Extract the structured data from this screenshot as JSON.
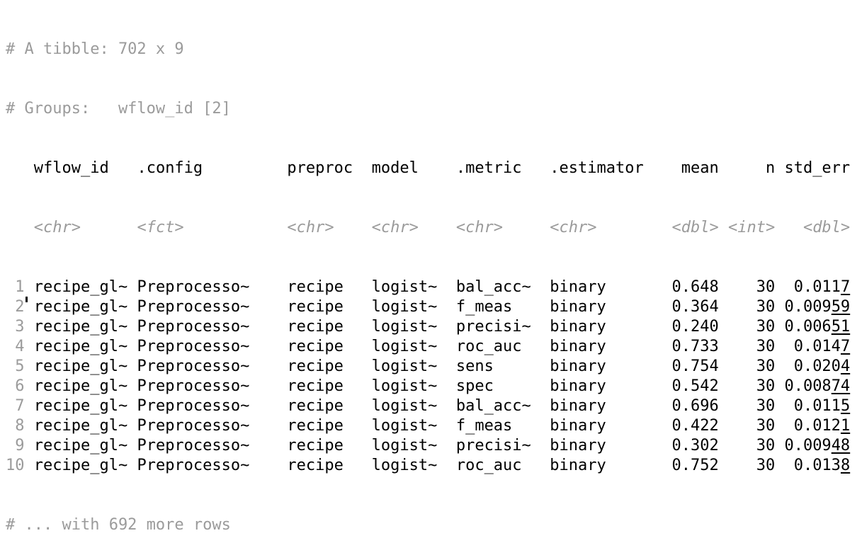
{
  "header": {
    "tibble_line": "# A tibble: 702 x 9",
    "groups_line": "# Groups:   wflow_id [2]"
  },
  "columns": [
    {
      "name": "wflow_id",
      "type": "<chr>",
      "width": 10,
      "align": "left"
    },
    {
      "name": ".config",
      "type": "<fct>",
      "width": 15,
      "align": "left"
    },
    {
      "name": "preproc",
      "type": "<chr>",
      "width": 8,
      "align": "left"
    },
    {
      "name": "model",
      "type": "<chr>",
      "width": 8,
      "align": "left"
    },
    {
      "name": ".metric",
      "type": "<chr>",
      "width": 9,
      "align": "left"
    },
    {
      "name": ".estimator",
      "type": "<chr>",
      "width": 10,
      "align": "left"
    },
    {
      "name": "mean",
      "type": "<dbl>",
      "width": 7,
      "align": "right"
    },
    {
      "name": "n",
      "type": "<int>",
      "width": 5,
      "align": "right"
    },
    {
      "name": "std_err",
      "type": "<dbl>",
      "width": 7,
      "align": "right"
    }
  ],
  "rows": [
    {
      "num": "1",
      "cells": [
        "recipe_gl~",
        "Preprocesso~",
        "recipe",
        "logist~",
        "bal_acc~",
        "binary",
        "0.648",
        "30"
      ],
      "se_main": "0.011",
      "se_ul": "7"
    },
    {
      "num": "2",
      "cells": [
        "recipe_gl~",
        "Preprocesso~",
        "recipe",
        "logist~",
        "f_meas",
        "binary",
        "0.364",
        "30"
      ],
      "se_main": "0.009",
      "se_ul": "59"
    },
    {
      "num": "3",
      "cells": [
        "recipe_gl~",
        "Preprocesso~",
        "recipe",
        "logist~",
        "precisi~",
        "binary",
        "0.240",
        "30"
      ],
      "se_main": "0.006",
      "se_ul": "51"
    },
    {
      "num": "4",
      "cells": [
        "recipe_gl~",
        "Preprocesso~",
        "recipe",
        "logist~",
        "roc_auc",
        "binary",
        "0.733",
        "30"
      ],
      "se_main": "0.014",
      "se_ul": "7"
    },
    {
      "num": "5",
      "cells": [
        "recipe_gl~",
        "Preprocesso~",
        "recipe",
        "logist~",
        "sens",
        "binary",
        "0.754",
        "30"
      ],
      "se_main": "0.020",
      "se_ul": "4"
    },
    {
      "num": "6",
      "cells": [
        "recipe_gl~",
        "Preprocesso~",
        "recipe",
        "logist~",
        "spec",
        "binary",
        "0.542",
        "30"
      ],
      "se_main": "0.008",
      "se_ul": "74"
    },
    {
      "num": "7",
      "cells": [
        "recipe_gl~",
        "Preprocesso~",
        "recipe",
        "logist~",
        "bal_acc~",
        "binary",
        "0.696",
        "30"
      ],
      "se_main": "0.011",
      "se_ul": "5"
    },
    {
      "num": "8",
      "cells": [
        "recipe_gl~",
        "Preprocesso~",
        "recipe",
        "logist~",
        "f_meas",
        "binary",
        "0.422",
        "30"
      ],
      "se_main": "0.012",
      "se_ul": "1"
    },
    {
      "num": "9",
      "cells": [
        "recipe_gl~",
        "Preprocesso~",
        "recipe",
        "logist~",
        "precisi~",
        "binary",
        "0.302",
        "30"
      ],
      "se_main": "0.009",
      "se_ul": "48"
    },
    {
      "num": "10",
      "cells": [
        "recipe_gl~",
        "Preprocesso~",
        "recipe",
        "logist~",
        "roc_auc",
        "binary",
        "0.752",
        "30"
      ],
      "se_main": "0.013",
      "se_ul": "8"
    }
  ],
  "footer": {
    "more_rows_line": "# ... with 692 more rows"
  }
}
